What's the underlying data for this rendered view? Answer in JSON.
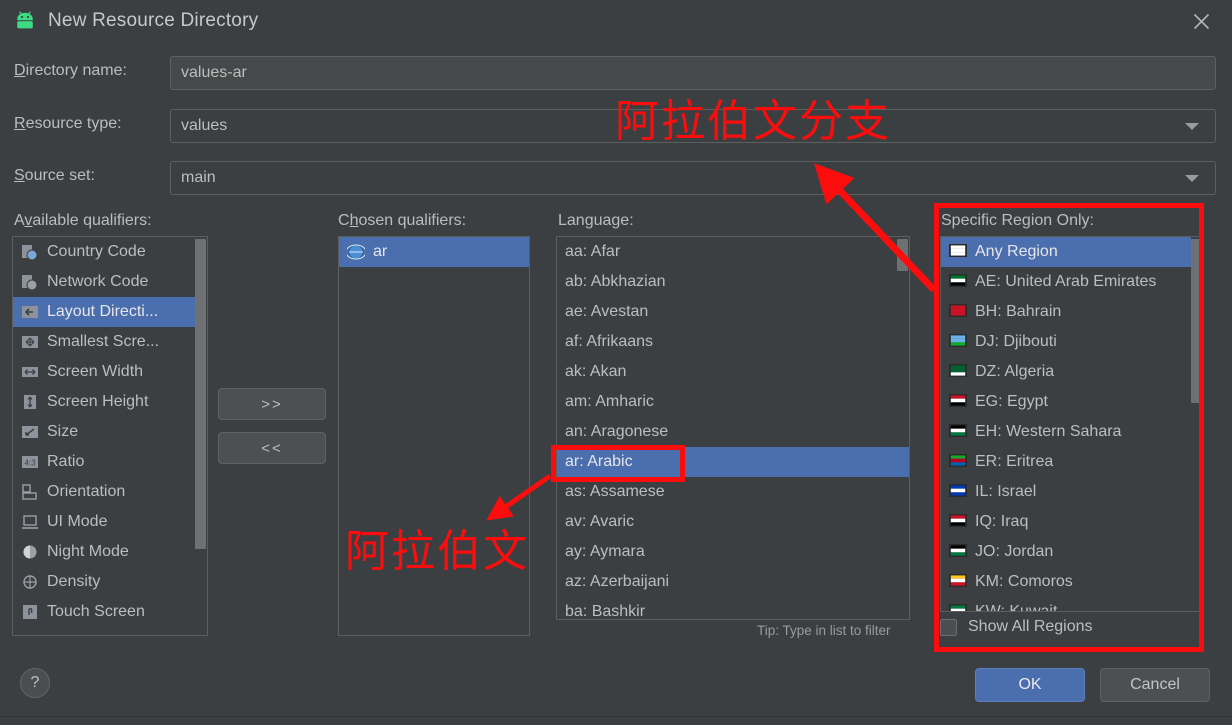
{
  "window": {
    "title": "New Resource Directory",
    "app_icon": "android-robot-icon",
    "close_icon": "close-icon"
  },
  "form": {
    "directory_name": {
      "label": "Directory name:",
      "accel": "D",
      "value": "values-ar"
    },
    "resource_type": {
      "label": "Resource type:",
      "accel": "R",
      "value": "values"
    },
    "source_set": {
      "label": "Source set:",
      "accel": "S",
      "value": "main"
    }
  },
  "available_qualifiers": {
    "heading": "Available qualifiers:",
    "accel": "v",
    "items": [
      {
        "label": "Country Code",
        "icon": "country-code-icon",
        "selected": false
      },
      {
        "label": "Network Code",
        "icon": "network-code-icon",
        "selected": false
      },
      {
        "label": "Layout Directi...",
        "icon": "layout-direction-icon",
        "selected": true
      },
      {
        "label": "Smallest Scre...",
        "icon": "smallest-screen-icon",
        "selected": false
      },
      {
        "label": "Screen Width",
        "icon": "screen-width-icon",
        "selected": false
      },
      {
        "label": "Screen Height",
        "icon": "screen-height-icon",
        "selected": false
      },
      {
        "label": "Size",
        "icon": "size-icon",
        "selected": false
      },
      {
        "label": "Ratio",
        "icon": "ratio-icon",
        "selected": false
      },
      {
        "label": "Orientation",
        "icon": "orientation-icon",
        "selected": false
      },
      {
        "label": "UI Mode",
        "icon": "ui-mode-icon",
        "selected": false
      },
      {
        "label": "Night Mode",
        "icon": "night-mode-icon",
        "selected": false
      },
      {
        "label": "Density",
        "icon": "density-icon",
        "selected": false
      },
      {
        "label": "Touch Screen",
        "icon": "touch-screen-icon",
        "selected": false
      }
    ]
  },
  "move_buttons": {
    "add": ">>",
    "remove": "<<"
  },
  "chosen_qualifiers": {
    "heading": "Chosen qualifiers:",
    "accel": "h",
    "items": [
      {
        "label": "ar",
        "icon": "globe-icon",
        "selected": true
      }
    ]
  },
  "language": {
    "heading": "Language:",
    "tip": "Tip: Type in list to filter",
    "items": [
      {
        "label": "aa: Afar",
        "selected": false
      },
      {
        "label": "ab: Abkhazian",
        "selected": false
      },
      {
        "label": "ae: Avestan",
        "selected": false
      },
      {
        "label": "af: Afrikaans",
        "selected": false
      },
      {
        "label": "ak: Akan",
        "selected": false
      },
      {
        "label": "am: Amharic",
        "selected": false
      },
      {
        "label": "an: Aragonese",
        "selected": false
      },
      {
        "label": "ar: Arabic",
        "selected": true
      },
      {
        "label": "as: Assamese",
        "selected": false
      },
      {
        "label": "av: Avaric",
        "selected": false
      },
      {
        "label": "ay: Aymara",
        "selected": false
      },
      {
        "label": "az: Azerbaijani",
        "selected": false
      },
      {
        "label": "ba: Bashkir",
        "selected": false
      }
    ]
  },
  "region": {
    "heading": "Specific Region Only:",
    "show_all_label": "Show All Regions",
    "show_all_checked": false,
    "items": [
      {
        "label": "Any Region",
        "flag": [
          "#ffffff",
          "#ffffff",
          "#ffffff"
        ],
        "selected": true
      },
      {
        "label": "AE: United Arab Emirates",
        "flag": [
          "#00732f",
          "#ffffff",
          "#000000"
        ],
        "selected": false
      },
      {
        "label": "BH: Bahrain",
        "flag": [
          "#ce1126",
          "#ce1126",
          "#ce1126"
        ],
        "selected": false
      },
      {
        "label": "DJ: Djibouti",
        "flag": [
          "#6ab2e7",
          "#6ab2e7",
          "#12ad2b"
        ],
        "selected": false
      },
      {
        "label": "DZ: Algeria",
        "flag": [
          "#006233",
          "#006233",
          "#ffffff"
        ],
        "selected": false
      },
      {
        "label": "EG: Egypt",
        "flag": [
          "#ce1126",
          "#ffffff",
          "#000000"
        ],
        "selected": false
      },
      {
        "label": "EH: Western Sahara",
        "flag": [
          "#000000",
          "#ffffff",
          "#007a3d"
        ],
        "selected": false
      },
      {
        "label": "ER: Eritrea",
        "flag": [
          "#12ad2b",
          "#be0027",
          "#0061ad"
        ],
        "selected": false
      },
      {
        "label": "IL: Israel",
        "flag": [
          "#0038b8",
          "#ffffff",
          "#0038b8"
        ],
        "selected": false
      },
      {
        "label": "IQ: Iraq",
        "flag": [
          "#ce1126",
          "#ffffff",
          "#000000"
        ],
        "selected": false
      },
      {
        "label": "JO: Jordan",
        "flag": [
          "#000000",
          "#ffffff",
          "#007a3d"
        ],
        "selected": false
      },
      {
        "label": "KM: Comoros",
        "flag": [
          "#ffc61e",
          "#ffffff",
          "#ce1126"
        ],
        "selected": false
      },
      {
        "label": "KW: Kuwait",
        "flag": [
          "#007a3d",
          "#ffffff",
          "#ce1126"
        ],
        "selected": false
      }
    ]
  },
  "footer": {
    "help_label": "?",
    "ok_label": "OK",
    "cancel_label": "Cancel"
  },
  "annotations": {
    "accent_color": "#fb0d0d",
    "top_note": "阿拉伯文分支",
    "left_note": "阿拉伯文"
  }
}
